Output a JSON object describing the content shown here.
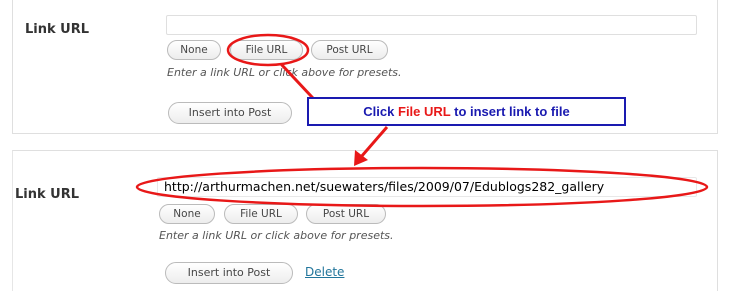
{
  "top_section": {
    "label": "Link URL",
    "url_value": "",
    "buttons": {
      "none": "None",
      "file_url": "File URL",
      "post_url": "Post URL"
    },
    "hint": "Enter a link URL or click above for presets.",
    "insert_button": "Insert into Post"
  },
  "callout": {
    "prefix": "Click",
    "highlight": "File URL",
    "suffix": "to insert link to file"
  },
  "bottom_section": {
    "label": "Link URL",
    "url_value": "http://arthurmachen.net/suewaters/files/2009/07/Edublogs282_gallery",
    "buttons": {
      "none": "None",
      "file_url": "File URL",
      "post_url": "Post URL"
    },
    "hint": "Enter a link URL or click above for presets.",
    "insert_button": "Insert into Post",
    "delete_link": "Delete"
  },
  "colors": {
    "annotation_red": "#e81818",
    "callout_navy": "#1a1ab0",
    "link_blue": "#21759b"
  }
}
